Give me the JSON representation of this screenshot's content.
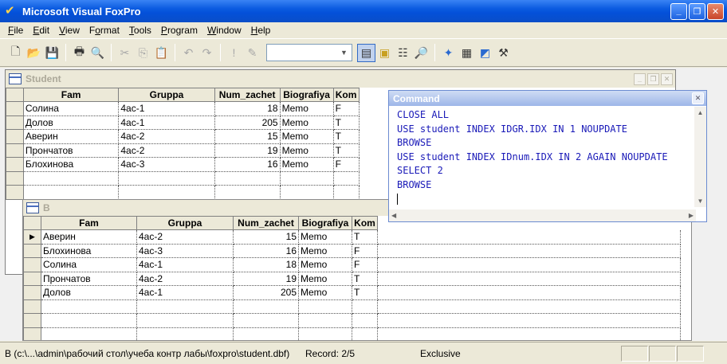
{
  "app": {
    "title": "Microsoft Visual FoxPro"
  },
  "menu": [
    {
      "label": "File",
      "accel": "F",
      "rest": "ile"
    },
    {
      "label": "Edit",
      "accel": "E",
      "rest": "dit"
    },
    {
      "label": "View",
      "accel": "V",
      "rest": "iew"
    },
    {
      "label": "Format",
      "accel": "o",
      "pre": "F",
      "rest": "rmat"
    },
    {
      "label": "Tools",
      "accel": "T",
      "rest": "ools"
    },
    {
      "label": "Program",
      "accel": "P",
      "rest": "rogram"
    },
    {
      "label": "Window",
      "accel": "W",
      "rest": "indow"
    },
    {
      "label": "Help",
      "accel": "H",
      "rest": "elp"
    }
  ],
  "student_window": {
    "title": "Student",
    "columns": [
      "Fam",
      "Gruppa",
      "Num_zachet",
      "Biografiya",
      "Kom"
    ],
    "rows": [
      [
        "Солина",
        "4ас-1",
        "18",
        "Memo",
        "F"
      ],
      [
        "Долов",
        "4ас-1",
        "205",
        "Memo",
        "T"
      ],
      [
        "Аверин",
        "4ас-2",
        "15",
        "Memo",
        "T"
      ],
      [
        "Прончатов",
        "4ас-2",
        "19",
        "Memo",
        "T"
      ],
      [
        "Блохинова",
        "4ас-3",
        "16",
        "Memo",
        "F"
      ]
    ]
  },
  "b_window": {
    "title": "B",
    "columns": [
      "Fam",
      "Gruppa",
      "Num_zachet",
      "Biografiya",
      "Kom"
    ],
    "rows": [
      [
        "Аверин",
        "4ас-2",
        "15",
        "Memo",
        "T"
      ],
      [
        "Блохинова",
        "4ас-3",
        "16",
        "Memo",
        "F"
      ],
      [
        "Солина",
        "4ас-1",
        "18",
        "Memo",
        "F"
      ],
      [
        "Прончатов",
        "4ас-2",
        "19",
        "Memo",
        "T"
      ],
      [
        "Долов",
        "4ас-1",
        "205",
        "Memo",
        "T"
      ]
    ],
    "current_row_marker": "▶"
  },
  "command_window": {
    "title": "Command",
    "lines": [
      "CLOSE ALL",
      "USE student INDEX IDGR.IDX IN 1 NOUPDATE",
      "BROWSE",
      "USE student INDEX IDnum.IDX IN 2 AGAIN NOUPDATE",
      "SELECT 2",
      "BROWSE"
    ]
  },
  "status": {
    "path": "B (c:\\...\\admin\\рабочий стол\\учеба контр лабы\\foxpro\\student.dbf)",
    "record": "Record: 2/5",
    "mode": "Exclusive"
  },
  "toolbar": {
    "icons": [
      "new-file-icon",
      "open-folder-icon",
      "save-icon",
      "print-icon",
      "print-preview-icon",
      "cut-icon",
      "copy-icon",
      "paste-icon",
      "undo-icon",
      "redo-icon",
      "run-icon",
      "modify-form-icon",
      "database-combo",
      "command-window-icon",
      "view-window-icon",
      "properties-window-icon",
      "code-window-icon",
      "form-wizard-icon",
      "report-icon",
      "builder-icon",
      "tools-icon"
    ]
  }
}
